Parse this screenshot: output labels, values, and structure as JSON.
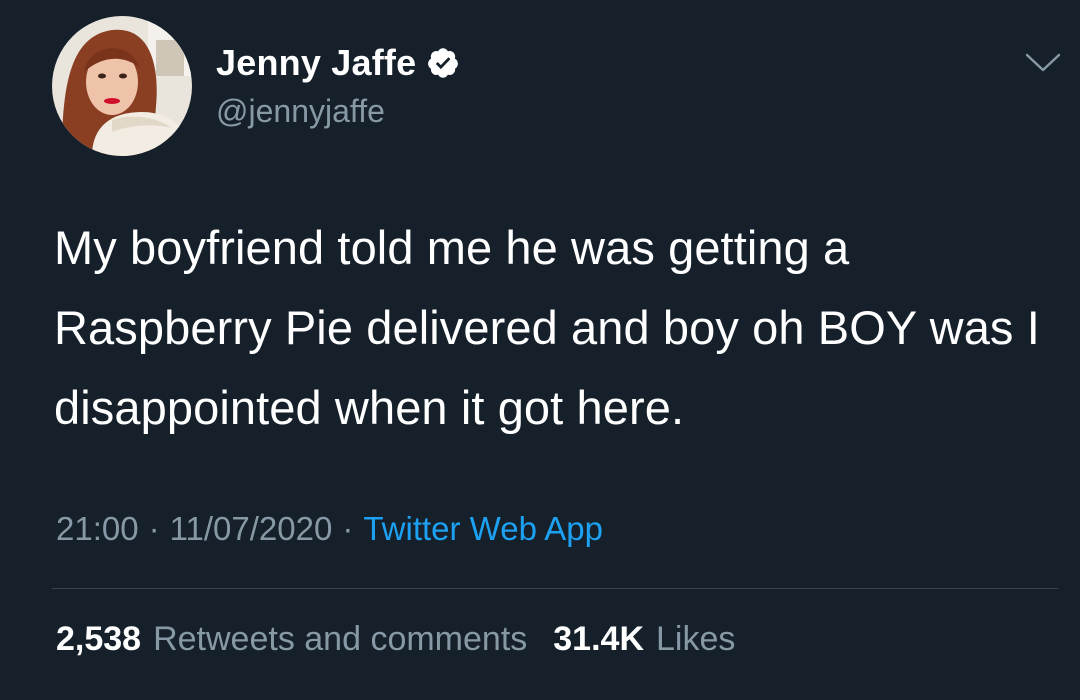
{
  "tweet": {
    "author": {
      "display_name": "Jenny Jaffe",
      "handle": "@jennyjaffe",
      "verified": true
    },
    "text": "My boyfriend told me he was getting a Raspberry Pie delivered and boy oh BOY was I disappointed when it got here.",
    "meta": {
      "time": "21:00",
      "separator": "·",
      "date": "11/07/2020",
      "source": "Twitter Web App"
    },
    "stats": {
      "retweets_count": "2,538",
      "retweets_label": "Retweets and comments",
      "likes_count": "31.4K",
      "likes_label": "Likes"
    }
  },
  "icons": {
    "verified": "verified-badge-icon",
    "more": "chevron-down-icon"
  },
  "colors": {
    "background": "#15202b",
    "primary_text": "#ffffff",
    "secondary_text": "#8899a6",
    "link": "#1da1f2",
    "divider": "#38444d"
  }
}
